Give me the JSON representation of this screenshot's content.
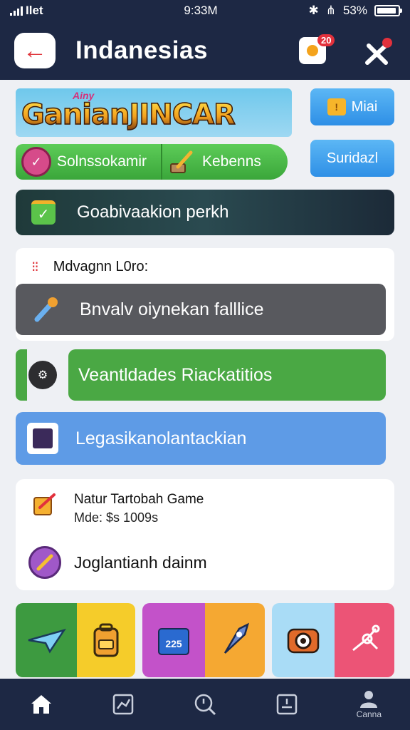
{
  "status_bar": {
    "carrier": "Ilet",
    "time": "9:33M",
    "battery": "53%"
  },
  "header": {
    "title": "Indanesias",
    "notification_count": "20"
  },
  "banner": {
    "logo_small": "Ainy",
    "logo_text": "GanianJINCAR",
    "mini_button": "Miai",
    "soft_button": "Suridazl",
    "pill_left": "Solnssokamir",
    "pill_right": "Kebenns",
    "dark_bar": "Goabivaakion perkh"
  },
  "menu": {
    "heading": "Mdvagnn L0ro:",
    "items": [
      {
        "label": "Bnvalv oiynekan falllice",
        "color": "#58595e"
      },
      {
        "label": "Veantldades Riackatitios",
        "color": "#4aa844"
      },
      {
        "label": "Legasikanolantackian",
        "color": "#5e9be6"
      }
    ]
  },
  "game_card": {
    "title": "Natur Tartobah Game",
    "subtitle": "Mde: $s 1009s",
    "item2": "Joglantianh dainm"
  },
  "tiles": [
    {
      "icon": "paper-plane-icon",
      "color": "#3d9a40"
    },
    {
      "icon": "backpack-icon",
      "color": "#f5cc2a"
    },
    {
      "icon": "calendar-icon",
      "color": "#c352c9",
      "text": "225"
    },
    {
      "icon": "rocket-icon",
      "color": "#f5a832"
    },
    {
      "icon": "camera-icon",
      "color": "#a9dcf6"
    },
    {
      "icon": "molecule-icon",
      "color": "#ec5476"
    }
  ],
  "bottom_nav": [
    {
      "icon": "home-icon",
      "label": ""
    },
    {
      "icon": "chart-icon",
      "label": ""
    },
    {
      "icon": "clock-search-icon",
      "label": ""
    },
    {
      "icon": "calendar-icon",
      "label": ""
    },
    {
      "icon": "profile-icon",
      "label": "Canna"
    }
  ]
}
